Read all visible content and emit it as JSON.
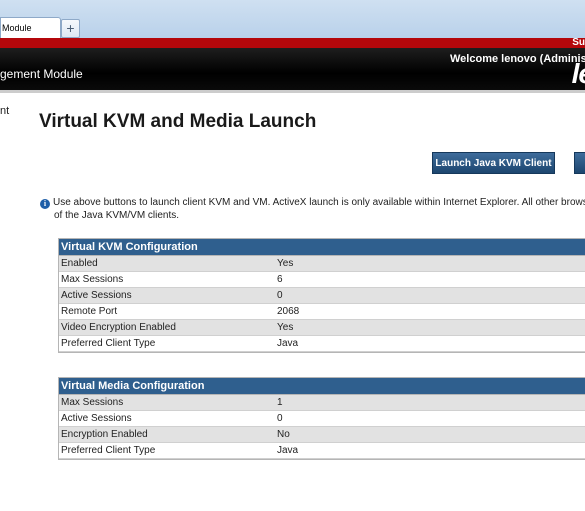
{
  "browser": {
    "tab_label": "Module",
    "new_tab_glyph": "+"
  },
  "banner": {
    "brand_fragment": "Su",
    "module_title": "gement Module",
    "welcome": "Welcome lenovo (Adminis",
    "logo_fragment": "le"
  },
  "nav": {
    "fragment": "nt"
  },
  "main": {
    "title": "Virtual KVM and Media Launch",
    "buttons": {
      "launch_java": "Launch Java KVM Client",
      "second": ""
    },
    "info_icon": "i",
    "info_line1": "Use above buttons to launch client KVM and VM. ActiveX launch is only available within Internet Explorer. All other browsers w",
    "info_line2": "of the Java KVM/VM clients."
  },
  "kvm_config": {
    "title": "Virtual KVM Configuration",
    "rows": [
      {
        "label": "Enabled",
        "value": "Yes"
      },
      {
        "label": "Max Sessions",
        "value": "6"
      },
      {
        "label": "Active Sessions",
        "value": "0"
      },
      {
        "label": "Remote Port",
        "value": "2068"
      },
      {
        "label": "Video Encryption Enabled",
        "value": "Yes"
      },
      {
        "label": "Preferred Client Type",
        "value": "Java"
      }
    ]
  },
  "media_config": {
    "title": "Virtual Media Configuration",
    "rows": [
      {
        "label": "Max Sessions",
        "value": "1"
      },
      {
        "label": "Active Sessions",
        "value": "0"
      },
      {
        "label": "Encryption Enabled",
        "value": "No"
      },
      {
        "label": "Preferred Client Type",
        "value": "Java"
      }
    ]
  },
  "colors": {
    "brand_red": "#b4070b",
    "header_black": "#000000",
    "table_header_blue": "#2f5f8e",
    "button_blue": "#2a5684"
  }
}
